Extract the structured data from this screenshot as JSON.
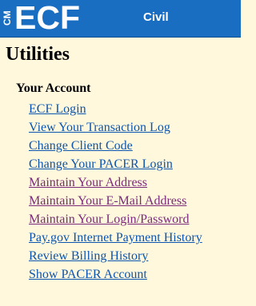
{
  "banner": {
    "logo_small": "CM",
    "logo_large": "ECF",
    "court_type": "Civil"
  },
  "page": {
    "title": "Utilities"
  },
  "your_account": {
    "heading": "Your Account",
    "links": [
      {
        "label": "ECF Login",
        "visited": false
      },
      {
        "label": "View Your Transaction Log",
        "visited": false
      },
      {
        "label": "Change Client Code",
        "visited": false
      },
      {
        "label": "Change Your PACER Login",
        "visited": false
      },
      {
        "label": "Maintain Your Address",
        "visited": true
      },
      {
        "label": "Maintain Your E-Mail Address",
        "visited": true
      },
      {
        "label": "Maintain Your Login/Password",
        "visited": true
      },
      {
        "label": "Pay.gov Internet Payment History",
        "visited": false
      },
      {
        "label": "Review Billing History",
        "visited": false
      },
      {
        "label": "Show PACER Account",
        "visited": false
      }
    ]
  },
  "colors": {
    "banner": "#1a6ec2",
    "background": "#fff8dc",
    "link": "#0b55b0",
    "visited_link": "#7a2a7a"
  }
}
